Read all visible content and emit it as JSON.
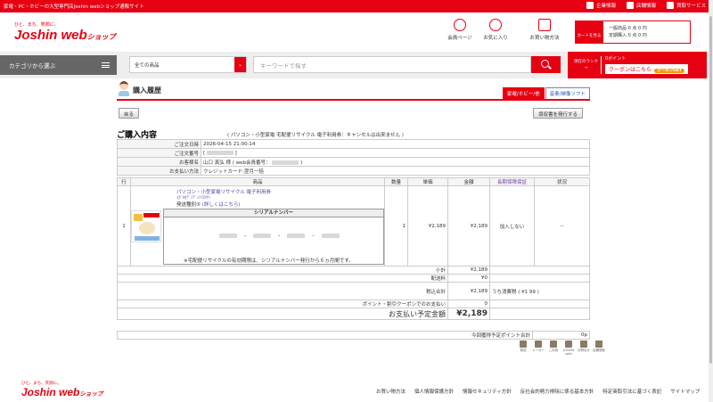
{
  "topbar": {
    "tagline": "家電・PC・ホビーの大型専門店Joshin webショップ通販サイト",
    "links": [
      "企業情報",
      "店舗情報",
      "買取サービス"
    ]
  },
  "header": {
    "logo_sub": "ひと、まち、笑顔に。",
    "logo_main": "Joshin web",
    "logo_small": "ショップ",
    "icons": [
      "会員ページ",
      "お気に入り",
      "お買い物方法"
    ],
    "cart_label": "カートを見る",
    "cart_line1": "一般商品 0 点 0 円",
    "cart_line2": "定期購入 0 点 0 円"
  },
  "nav": {
    "category_label": "カテゴリから選ぶ",
    "select_value": "全ての商品",
    "search_placeholder": "キーワードで探す",
    "rank_line1": "現在のランク",
    "rank_line2": "→",
    "point_label": "0ポイント",
    "coupon_label": "クーポンはこちら",
    "coupon_badge": "クーポンGET"
  },
  "page": {
    "title": "購入履歴",
    "tabs": [
      "家電/ホビー/他",
      "音楽/映像ソフト"
    ],
    "back_button": "戻る",
    "receipt_button": "領収書を発行する",
    "section_title": "ご購入内容",
    "section_note": "( パソコン・小型家電 宅配便リサイクル 電子利用券：キャンセルは出来ません )"
  },
  "order_info": {
    "date_label": "ご注文日時",
    "date_value": "2026-04-15 21:00:14",
    "number_label": "ご注文番号",
    "name_label": "お客様名",
    "name_value": "山口 真弘 様",
    "member_label": "( web会員番号：",
    "payment_label": "お支払い方法",
    "payment_value": "クレジットカード:翌月一括"
  },
  "items_table": {
    "headers": [
      "行",
      "商品",
      "数量",
      "単価",
      "金額",
      "長期保障保証",
      "状況"
    ],
    "row_no": "1",
    "product_name": "パソコン・小型家電リサイクル 電子利用券",
    "product_sub": "ｺｶﾞﾀｶﾃﾞﾝﾃﾞﾝｼﾘﾖｳｹﾝ",
    "shipping_type": "発送種別⑤",
    "details_link": "(詳しくはこちら)",
    "qty": "1",
    "unit_price": "¥2,189",
    "amount": "¥2,189",
    "warranty": "加入しない",
    "status": "--",
    "serial_header": "シリアルナンバー",
    "serial_note": "※宅配便リサイクルの有効期限は、シリアルナンバー発行から６ヵ月間です。"
  },
  "totals": {
    "subtotal_label": "小計",
    "subtotal_value": "¥2,189",
    "shipping_label": "配送料",
    "shipping_value": "¥0",
    "tax_label": "税込合計",
    "tax_value": "¥2,189",
    "tax_note_label": "うち消費税",
    "tax_note_value": "( ¥1 99 )",
    "points_label": "ポイント・割引クーポンでのお支払い",
    "points_value": "0",
    "payment_label": "お支払い予定金額",
    "payment_value": "¥2,189",
    "earned_label": "今回獲得予定ポイント合計",
    "earned_value": "0p"
  },
  "bottom_icons": [
    "発送",
    "メーカー",
    "ご利用",
    "JOSHIN web",
    "お問合せ",
    "店舗受取"
  ],
  "footer": {
    "logo_sub": "ひと、まち、笑顔に。",
    "logo_main": "Joshin web",
    "logo_small": "ショップ",
    "links": [
      "お買い物方法",
      "個人情報保護方針",
      "情報セキュリティ方針",
      "反社会的勢力排除に係る基本方針",
      "特定商取引法に基づく表記",
      "サイトマップ"
    ]
  }
}
